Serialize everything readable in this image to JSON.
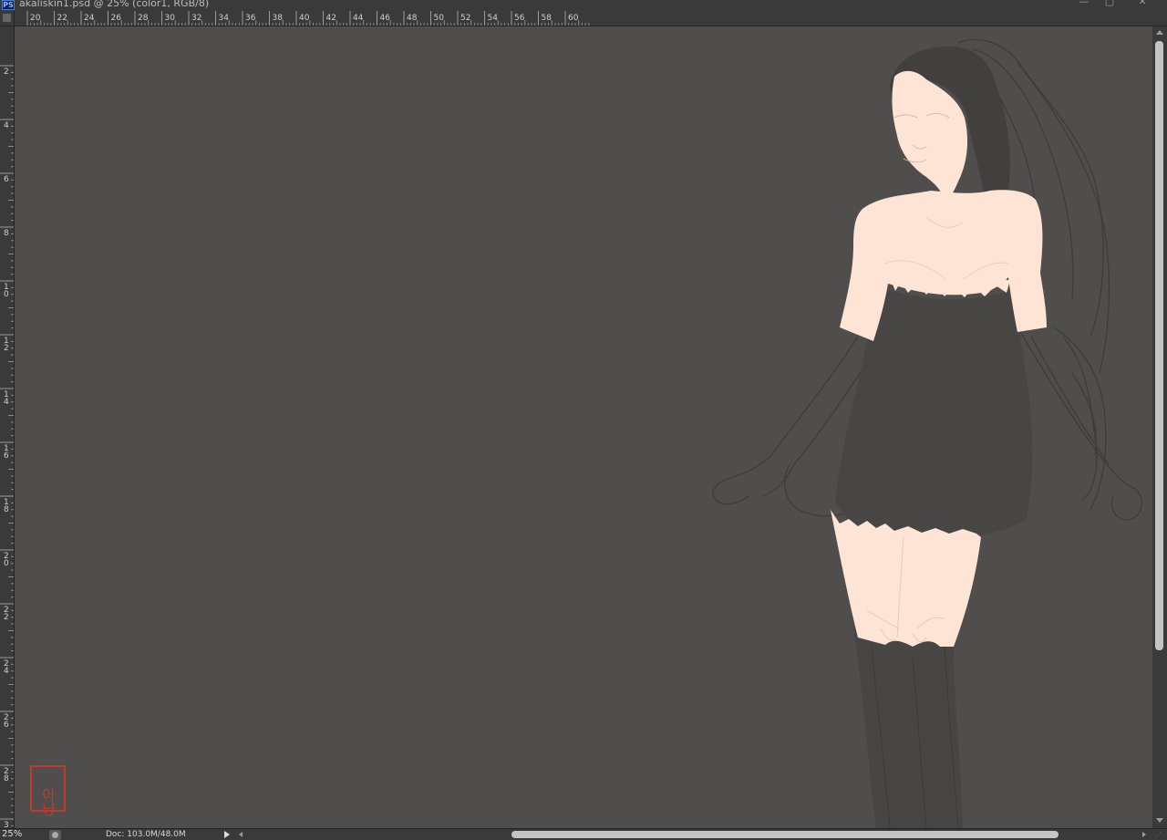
{
  "window": {
    "app_icon": "PS",
    "title": "akaliskin1.psd @ 25% (color1, RGB/8)",
    "controls": {
      "minimize": "—",
      "maximize": "▢",
      "close": "✕"
    }
  },
  "rulers": {
    "horizontal_labels": [
      "20",
      "22",
      "24",
      "26",
      "28",
      "30",
      "32",
      "34",
      "36",
      "38",
      "40",
      "42",
      "44",
      "46",
      "48",
      "50",
      "52",
      "54",
      "56",
      "58",
      "60"
    ],
    "vertical_labels": [
      [
        "2"
      ],
      [
        "4"
      ],
      [
        "6"
      ],
      [
        "8"
      ],
      [
        "1",
        "0"
      ],
      [
        "1",
        "2"
      ],
      [
        "1",
        "4"
      ],
      [
        "1",
        "6"
      ],
      [
        "1",
        "8"
      ],
      [
        "2",
        "0"
      ],
      [
        "2",
        "2"
      ],
      [
        "2",
        "4"
      ],
      [
        "2",
        "6"
      ],
      [
        "2",
        "8"
      ],
      [
        "3"
      ]
    ]
  },
  "canvas": {
    "background_color": "#4f4e4d",
    "skin_color": "#fde4d4",
    "dark_color": "#4a4948",
    "sketch_line_color": "#3c3b3a",
    "seal_color": "#c0392b",
    "seal_text": "아냥"
  },
  "status": {
    "zoom": "25%",
    "doc_info": "Doc: 103.0M/48.0M"
  },
  "icons": {
    "menu_arrow": "play-triangle-icon",
    "scroll_left": "chevron-left-icon",
    "scroll_right": "chevron-right-icon"
  }
}
